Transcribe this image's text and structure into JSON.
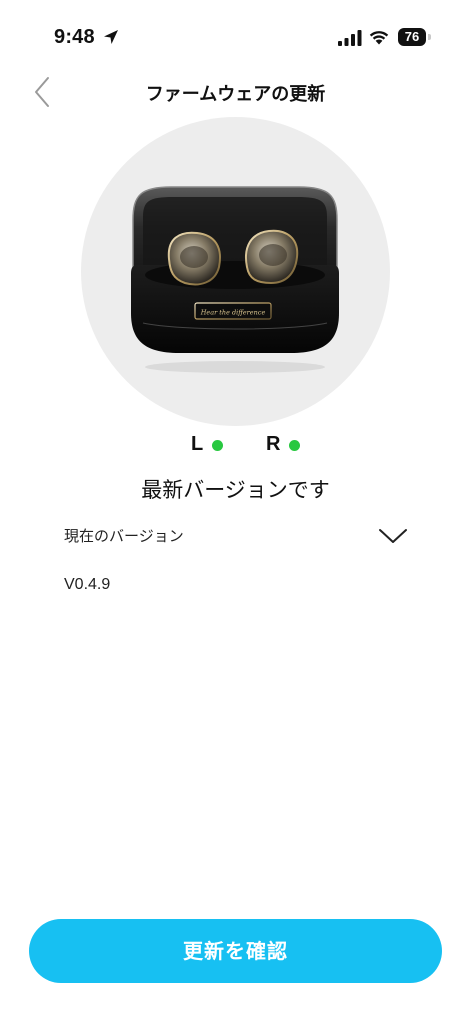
{
  "status_bar": {
    "time": "9:48",
    "battery": "76"
  },
  "header": {
    "title": "ファームウェアの更新"
  },
  "product": {
    "engraving": "Hear the difference"
  },
  "earbuds": {
    "left_label": "L",
    "right_label": "R",
    "connected_color": "#28c840"
  },
  "firmware": {
    "status": "最新バージョンです",
    "current_version_label": "現在のバージョン",
    "current_version_value": "V0.4.9"
  },
  "actions": {
    "confirm_label": "更新を確認"
  },
  "colors": {
    "accent": "#17c0f2"
  }
}
